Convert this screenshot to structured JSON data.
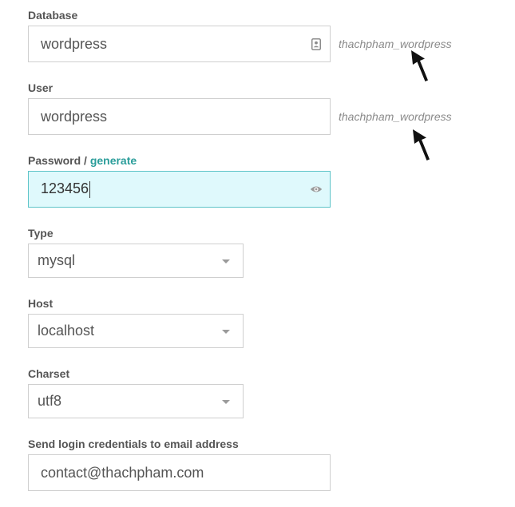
{
  "database": {
    "label": "Database",
    "value": "wordpress",
    "icon": "contact-card-icon",
    "hint": "thachpham_wordpress"
  },
  "user": {
    "label": "User",
    "value": "wordpress",
    "hint": "thachpham_wordpress"
  },
  "password": {
    "label": "Password",
    "separator": " / ",
    "generate_link": "generate",
    "value": "123456",
    "icon": "eye-icon"
  },
  "type": {
    "label": "Type",
    "selected": "mysql"
  },
  "host": {
    "label": "Host",
    "selected": "localhost"
  },
  "charset": {
    "label": "Charset",
    "selected": "utf8"
  },
  "email": {
    "label": "Send login credentials to email address",
    "value": "contact@thachpham.com"
  },
  "colors": {
    "accent": "#2a9d9a",
    "focused_bg": "#dff9fc",
    "focused_border": "#5dc4c8",
    "border": "#cfcfcf"
  }
}
